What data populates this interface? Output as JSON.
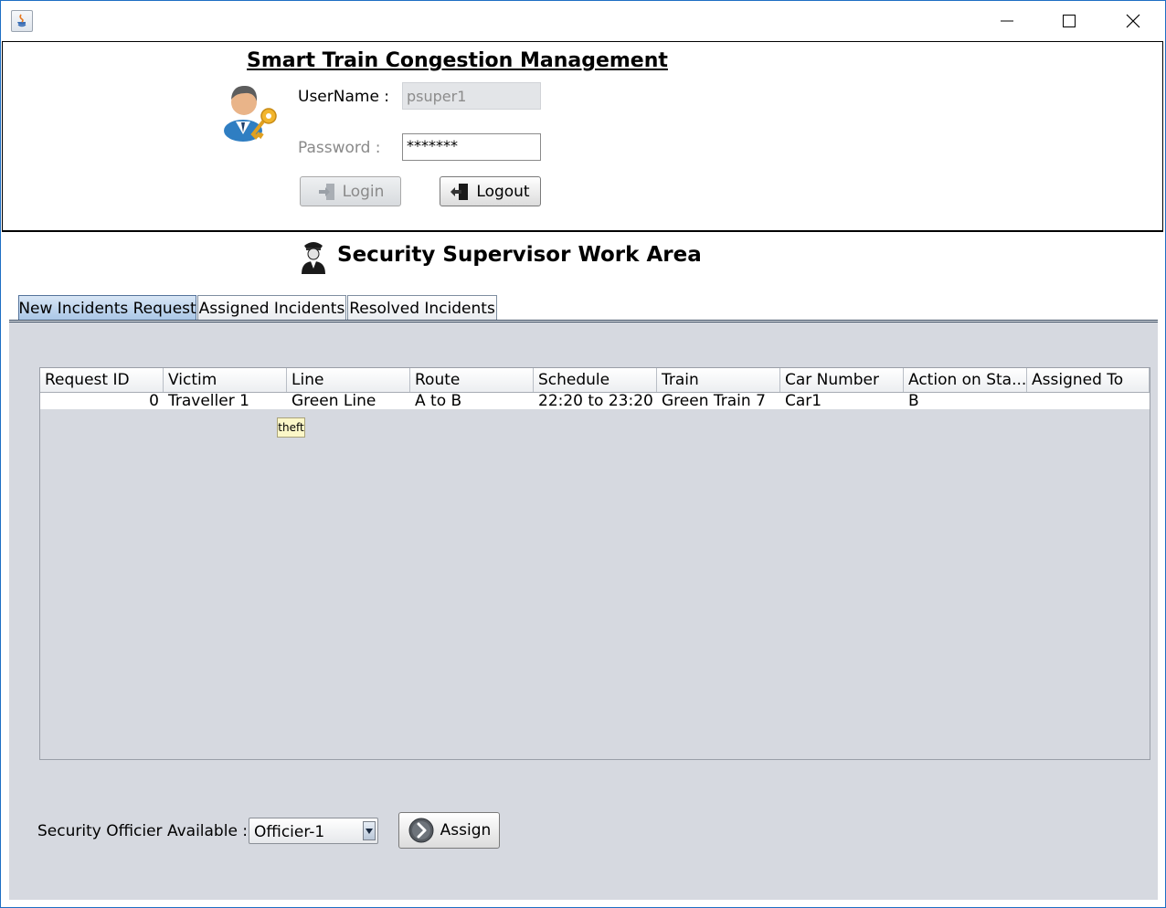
{
  "window": {
    "controls": {
      "minimize": "minimize",
      "maximize": "maximize",
      "close": "close"
    }
  },
  "header": {
    "title": "Smart Train Congestion Management",
    "username_label": "UserName :",
    "username_value": "psuper1",
    "password_label": "Password :",
    "password_value": "*******",
    "login_button": "Login",
    "logout_button": "Logout"
  },
  "work_area": {
    "title": "Security Supervisor Work Area",
    "tabs": [
      {
        "label": "New Incidents Request",
        "active": true
      },
      {
        "label": "Assigned Incidents",
        "active": false
      },
      {
        "label": "Resolved Incidents",
        "active": false
      }
    ]
  },
  "table": {
    "columns": [
      "Request ID",
      "Victim",
      "Line",
      "Route",
      "Schedule",
      "Train",
      "Car Number",
      "Action on Sta...",
      "Assigned To"
    ],
    "rows": [
      [
        "0",
        "Traveller 1",
        "Green Line",
        "A to B",
        "22:20 to 23:20",
        "Green Train 7",
        "Car1",
        "B",
        ""
      ]
    ],
    "tooltip": "theft"
  },
  "assign": {
    "label": "Security Officier Available :",
    "selected_officer": "Officier-1",
    "button": "Assign"
  },
  "icons": {
    "app": "java-icon",
    "user": "user-key-icon",
    "supervisor": "security-officer-icon",
    "login": "login-door-icon",
    "logout": "logout-door-icon",
    "assign": "arrow-circle-icon"
  }
}
